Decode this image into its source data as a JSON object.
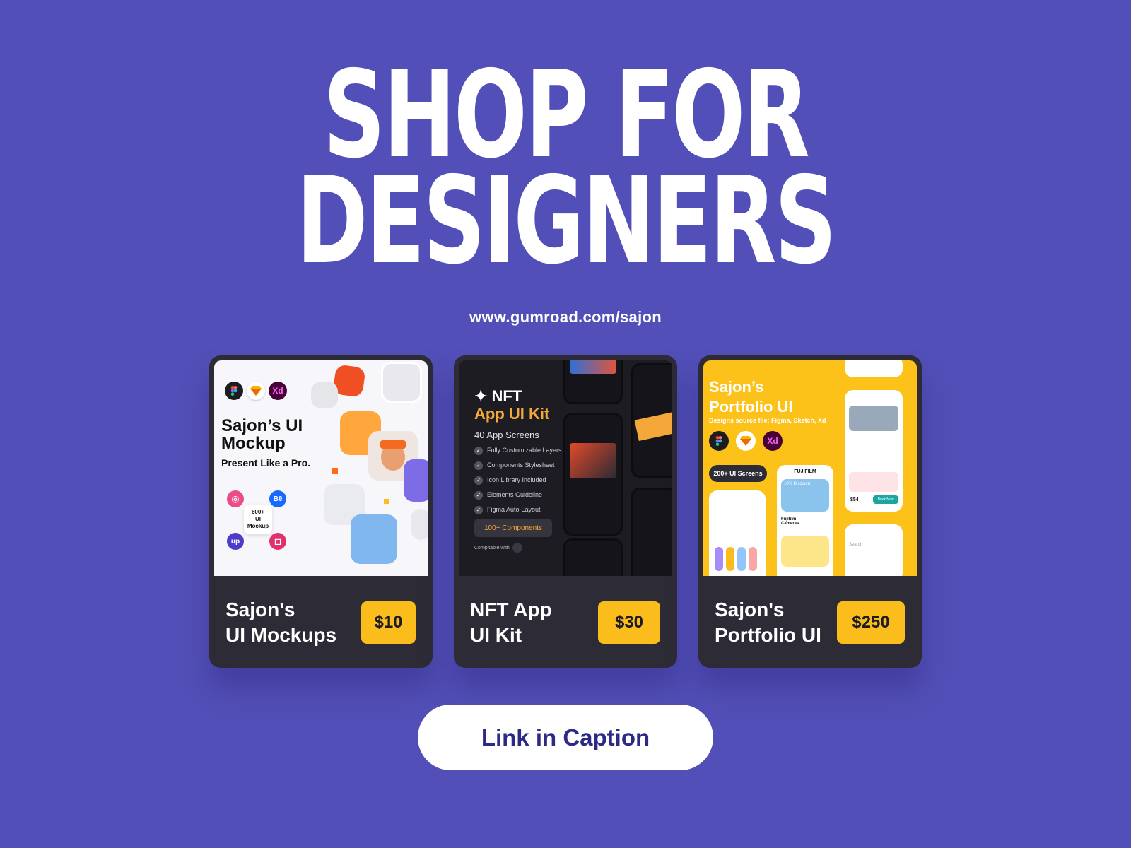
{
  "headline": {
    "line1": "SHOP FOR",
    "line2": "DESIGNERS"
  },
  "url": "www.gumroad.com/sajon",
  "cards": [
    {
      "title_line1": "Sajon's",
      "title_line2": "UI Mockups",
      "price": "$10",
      "preview": {
        "heading_line1": "Sajon’s UI",
        "heading_line2": "Mockup",
        "tagline": "Present Like a Pro.",
        "badge_line1": "600+",
        "badge_line2": "UI",
        "badge_line3": "Mockup",
        "xd": "Xd",
        "be": "Bē",
        "up": "up"
      }
    },
    {
      "title_line1": "NFT App",
      "title_line2": "UI Kit",
      "price": "$30",
      "preview": {
        "heading_line1": "✦ NFT",
        "heading_line2": "App UI Kit",
        "subheading": "40 App Screens",
        "features": [
          "Fully Customizable Layers",
          "Components Stylesheet",
          "Icon Library Included",
          "Elements Guideline",
          "Figma Auto-Layout"
        ],
        "components": "100+ Components",
        "compatible": "Compitable with"
      }
    },
    {
      "title_line1": "Sajon's",
      "title_line2": "Portfolio UI",
      "price": "$250",
      "preview": {
        "heading_line1": "Sajon’s",
        "heading_line2": "Portfolio UI",
        "subheading": "Designs source file: Figma, Sketch, Xd",
        "screens": "200+ UI Screens",
        "xd": "Xd",
        "fujifilm": "FUJIFILM",
        "discount": "10% Discount",
        "cameras": "Fujifilm Cameras",
        "price_tag": "$54",
        "book": "Book Now",
        "search": "Search"
      }
    }
  ],
  "cta": "Link in Caption",
  "colors": {
    "background": "#5250b8",
    "card": "#2d2b36",
    "price": "#fbbd1c",
    "cta_text": "#2d2a86"
  }
}
